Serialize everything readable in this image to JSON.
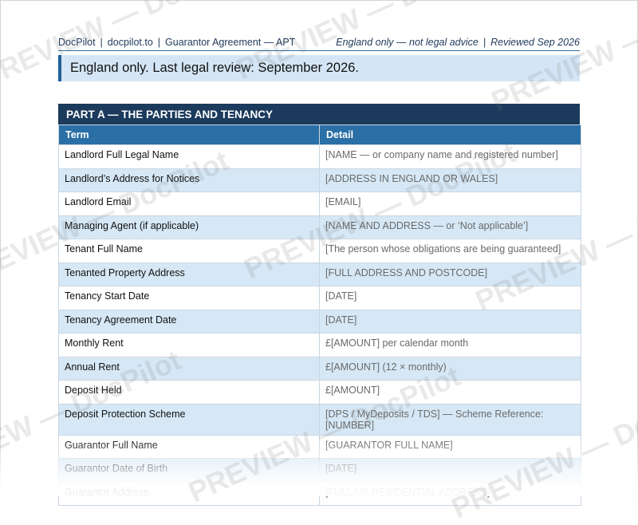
{
  "header": {
    "brand": "DocPilot",
    "site": "docpilot.to",
    "doc_title": "Guarantor Agreement — APT",
    "scope": "England only — not legal advice",
    "reviewed": "Reviewed Sep 2026",
    "separator": "|"
  },
  "callout": {
    "text": "England only. Last legal review: September 2026."
  },
  "part_a": {
    "title": "PART A — THE PARTIES AND TENANCY",
    "columns": [
      "Term",
      "Detail"
    ],
    "rows": [
      {
        "term": "Landlord Full Legal Name",
        "detail": "[NAME — or company name and registered number]"
      },
      {
        "term": "Landlord’s Address for Notices",
        "detail": "[ADDRESS IN ENGLAND OR WALES]"
      },
      {
        "term": "Landlord Email",
        "detail": "[EMAIL]"
      },
      {
        "term": "Managing Agent (if applicable)",
        "detail": "[NAME AND ADDRESS — or ‘Not applicable’]"
      },
      {
        "term": "Tenant Full Name",
        "detail": "[The person whose obligations are being guaranteed]"
      },
      {
        "term": "Tenanted Property Address",
        "detail": "[FULL ADDRESS AND POSTCODE]"
      },
      {
        "term": "Tenancy Start Date",
        "detail": "[DATE]"
      },
      {
        "term": "Tenancy Agreement Date",
        "detail": "[DATE]"
      },
      {
        "term": "Monthly Rent",
        "detail": "£[AMOUNT] per calendar month"
      },
      {
        "term": "Annual Rent",
        "detail": "£[AMOUNT] (12 × monthly)"
      },
      {
        "term": "Deposit Held",
        "detail": "£[AMOUNT]"
      },
      {
        "term": "Deposit Protection Scheme",
        "detail": "[DPS / MyDeposits / TDS] — Scheme Reference: [NUMBER]"
      },
      {
        "term": "Guarantor Full Name",
        "detail": "[GUARANTOR FULL NAME]"
      },
      {
        "term": "Guarantor Date of Birth",
        "detail": "[DATE]"
      },
      {
        "term": "Guarantor Address",
        "detail": "[FULL UK RESIDENTIAL ADDRESS]"
      }
    ]
  },
  "watermark": {
    "text": "PREVIEW — DocPilot"
  }
}
